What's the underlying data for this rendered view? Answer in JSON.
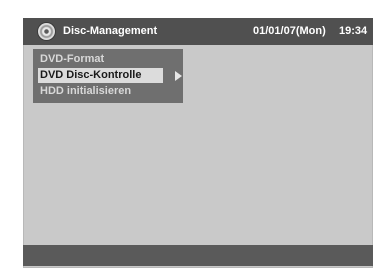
{
  "header": {
    "icon": "disc-icon",
    "title": "Disc-Management",
    "date": "01/01/07(Mon)",
    "time": "19:34"
  },
  "menu": {
    "items": [
      {
        "label": "DVD-Format",
        "selected": false
      },
      {
        "label": "DVD Disc-Kontrolle",
        "selected": true
      },
      {
        "label": "HDD initialisieren",
        "selected": false
      }
    ],
    "submenu_indicator": "arrow-right-icon"
  },
  "colors": {
    "panel_bg": "#c9c9c9",
    "header_bg": "#505050",
    "menu_bg": "#6f6f6f",
    "selected_bg": "#dcdcdc",
    "footer_bg": "#5a5a5a"
  }
}
